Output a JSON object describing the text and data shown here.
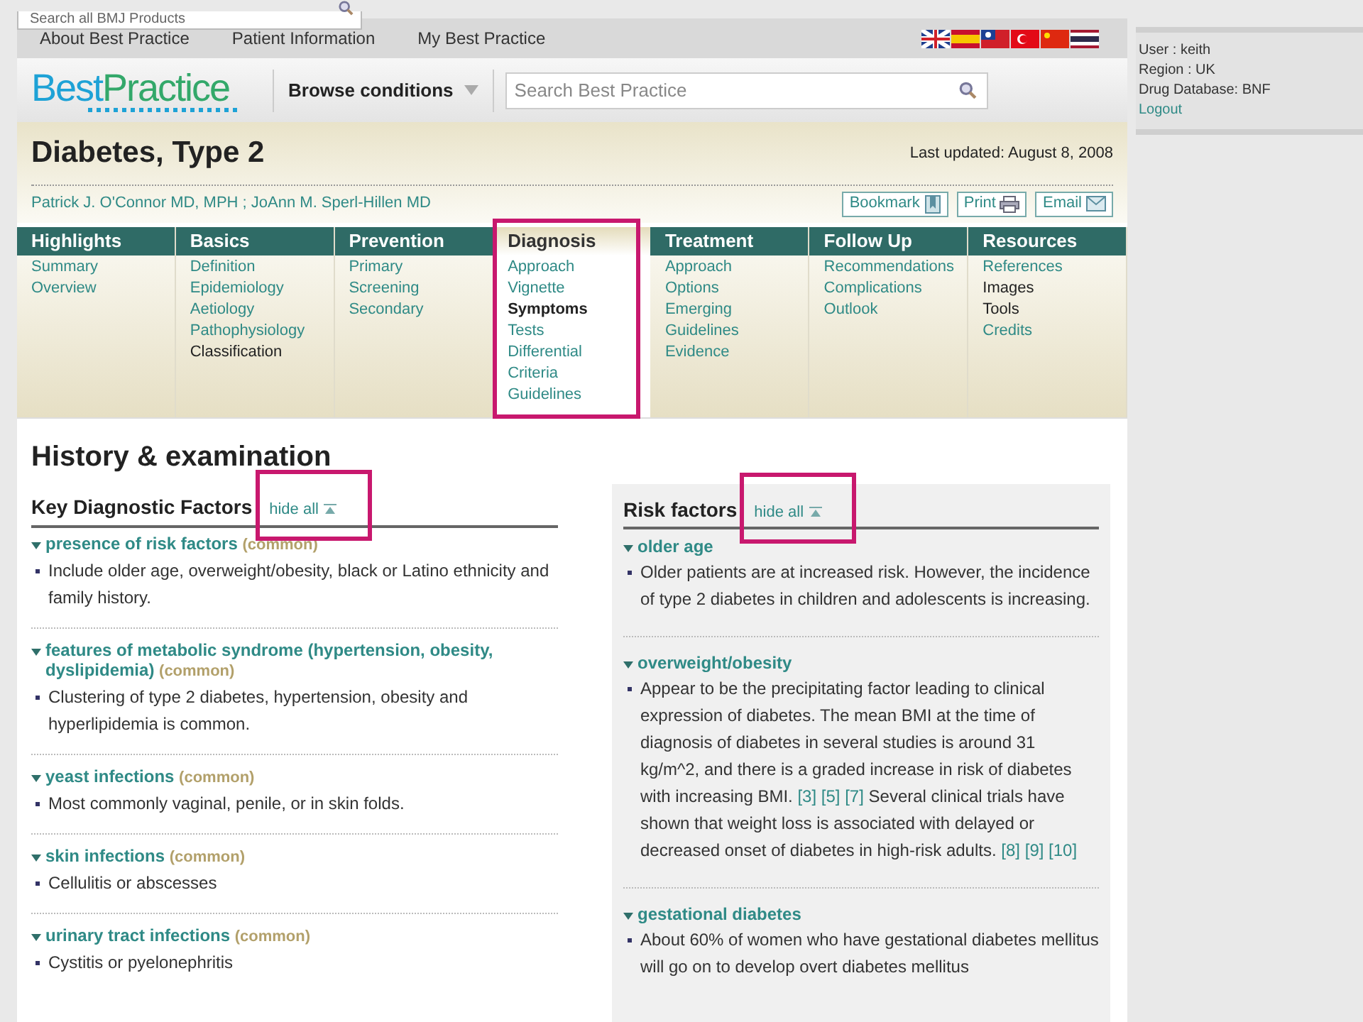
{
  "top_search": {
    "placeholder": "Search all BMJ Products"
  },
  "top_links": [
    "About Best Practice",
    "Patient Information",
    "My Best Practice"
  ],
  "languages": [
    {
      "kind": "uk"
    },
    {
      "kind": "es"
    },
    {
      "kind": "tw"
    },
    {
      "kind": "tr"
    },
    {
      "kind": "cn"
    },
    {
      "kind": "th"
    }
  ],
  "logo": {
    "part_1": "Best",
    "part_2": "Practice"
  },
  "browse": "Browse conditions",
  "search": {
    "placeholder": "Search Best Practice"
  },
  "user_panel": {
    "user": "User : keith",
    "region": "Region : UK",
    "drug_db": "Drug Database: BNF",
    "logout": "Logout"
  },
  "title": "Diabetes, Type 2",
  "last_updated": "Last updated: August 8, 2008",
  "authors": "Patrick J. O'Connor MD, MPH ; JoAnn M. Sperl-Hillen MD",
  "actions": [
    {
      "label": "Bookmark",
      "kind": "bookmark"
    },
    {
      "label": "Print",
      "kind": "print"
    },
    {
      "label": "Email",
      "kind": "email"
    }
  ],
  "nav": [
    {
      "label": "Highlights",
      "selected": false,
      "highlighted": false,
      "items": [
        {
          "label": "Summary",
          "link": true
        },
        {
          "label": "Overview",
          "link": true
        }
      ]
    },
    {
      "label": "Basics",
      "selected": false,
      "highlighted": false,
      "items": [
        {
          "label": "Definition",
          "link": true
        },
        {
          "label": "Epidemiology",
          "link": true
        },
        {
          "label": "Aetiology",
          "link": true
        },
        {
          "label": "Pathophysiology",
          "link": true
        },
        {
          "label": "Classification",
          "link": false
        }
      ]
    },
    {
      "label": "Prevention",
      "selected": false,
      "highlighted": false,
      "items": [
        {
          "label": "Primary",
          "link": true
        },
        {
          "label": "Screening",
          "link": true
        },
        {
          "label": "Secondary",
          "link": true
        }
      ]
    },
    {
      "label": "Diagnosis",
      "selected": true,
      "highlighted": true,
      "items": [
        {
          "label": "Approach",
          "link": true
        },
        {
          "label": "Vignette",
          "link": true
        },
        {
          "label": "Symptoms",
          "link": false,
          "current": true
        },
        {
          "label": "Tests",
          "link": true
        },
        {
          "label": "Differential",
          "link": true
        },
        {
          "label": "Criteria",
          "link": true
        },
        {
          "label": "Guidelines",
          "link": true
        }
      ]
    },
    {
      "label": "Treatment",
      "selected": false,
      "highlighted": false,
      "items": [
        {
          "label": "Approach",
          "link": true
        },
        {
          "label": "Options",
          "link": true
        },
        {
          "label": "Emerging",
          "link": true
        },
        {
          "label": "Guidelines",
          "link": true
        },
        {
          "label": "Evidence",
          "link": true
        }
      ]
    },
    {
      "label": "Follow Up",
      "selected": false,
      "highlighted": false,
      "items": [
        {
          "label": "Recommendations",
          "link": true
        },
        {
          "label": "Complications",
          "link": true
        },
        {
          "label": "Outlook",
          "link": true
        }
      ]
    },
    {
      "label": "Resources",
      "selected": false,
      "highlighted": false,
      "items": [
        {
          "label": "References",
          "link": true
        },
        {
          "label": "Images",
          "link": false
        },
        {
          "label": "Tools",
          "link": false
        },
        {
          "label": "Credits",
          "link": true
        }
      ]
    }
  ],
  "heading": "History & examination",
  "key_factors": {
    "title": "Key Diagnostic Factors",
    "hide_all": "hide all",
    "highlighted": true,
    "items": [
      {
        "name": "presence of risk factors",
        "note": "(common)",
        "expanded": true,
        "text": "Include older age, overweight/obesity, black or Latino ethnicity and family history."
      },
      {
        "name": "features of metabolic syndrome (hypertension, obesity, dyslipidemia)",
        "note": "(common)",
        "expanded": true,
        "text": "Clustering of type 2 diabetes, hypertension, obesity and hyperlipidemia is common."
      },
      {
        "name": "yeast infections",
        "note": "(common)",
        "expanded": true,
        "text": "Most commonly vaginal, penile, or in skin folds."
      },
      {
        "name": "skin infections",
        "note": "(common)",
        "expanded": true,
        "text": "Cellulitis or abscesses"
      },
      {
        "name": "urinary tract infections",
        "note": "(common)",
        "expanded": true,
        "text": "Cystitis or pyelonephritis"
      }
    ]
  },
  "risk_factors": {
    "title": "Risk factors",
    "hide_all": "hide all",
    "highlighted": true,
    "items": [
      {
        "name": "older age",
        "expanded": true,
        "parts": [
          {
            "kind": "text",
            "text": "Older patients are at increased risk. However, the incidence of type 2 diabetes in children and adolescents is increasing."
          }
        ]
      },
      {
        "name": "overweight/obesity",
        "expanded": true,
        "parts": [
          {
            "kind": "text",
            "text": "Appear to be the precipitating factor leading to clinical expression of diabetes. The mean BMI at the time of diagnosis of diabetes in several studies is around 31 kg/m^2, and there is a graded increase in risk of diabetes with increasing BMI."
          },
          {
            "kind": "ref",
            "text": "[3]"
          },
          {
            "kind": "ref",
            "text": "[5]"
          },
          {
            "kind": "ref",
            "text": "[7]"
          },
          {
            "kind": "text",
            "text": " Several clinical trials have shown that weight loss is associated with delayed or decreased onset of diabetes in high-risk adults."
          },
          {
            "kind": "ref",
            "text": "[8]"
          },
          {
            "kind": "ref",
            "text": "[9]"
          },
          {
            "kind": "ref",
            "text": "[10]"
          }
        ]
      },
      {
        "name": "gestational diabetes",
        "expanded": true,
        "parts": [
          {
            "kind": "text",
            "text": "About 60% of women who have gestational diabetes mellitus will go on to develop overt diabetes mellitus"
          }
        ]
      }
    ]
  }
}
